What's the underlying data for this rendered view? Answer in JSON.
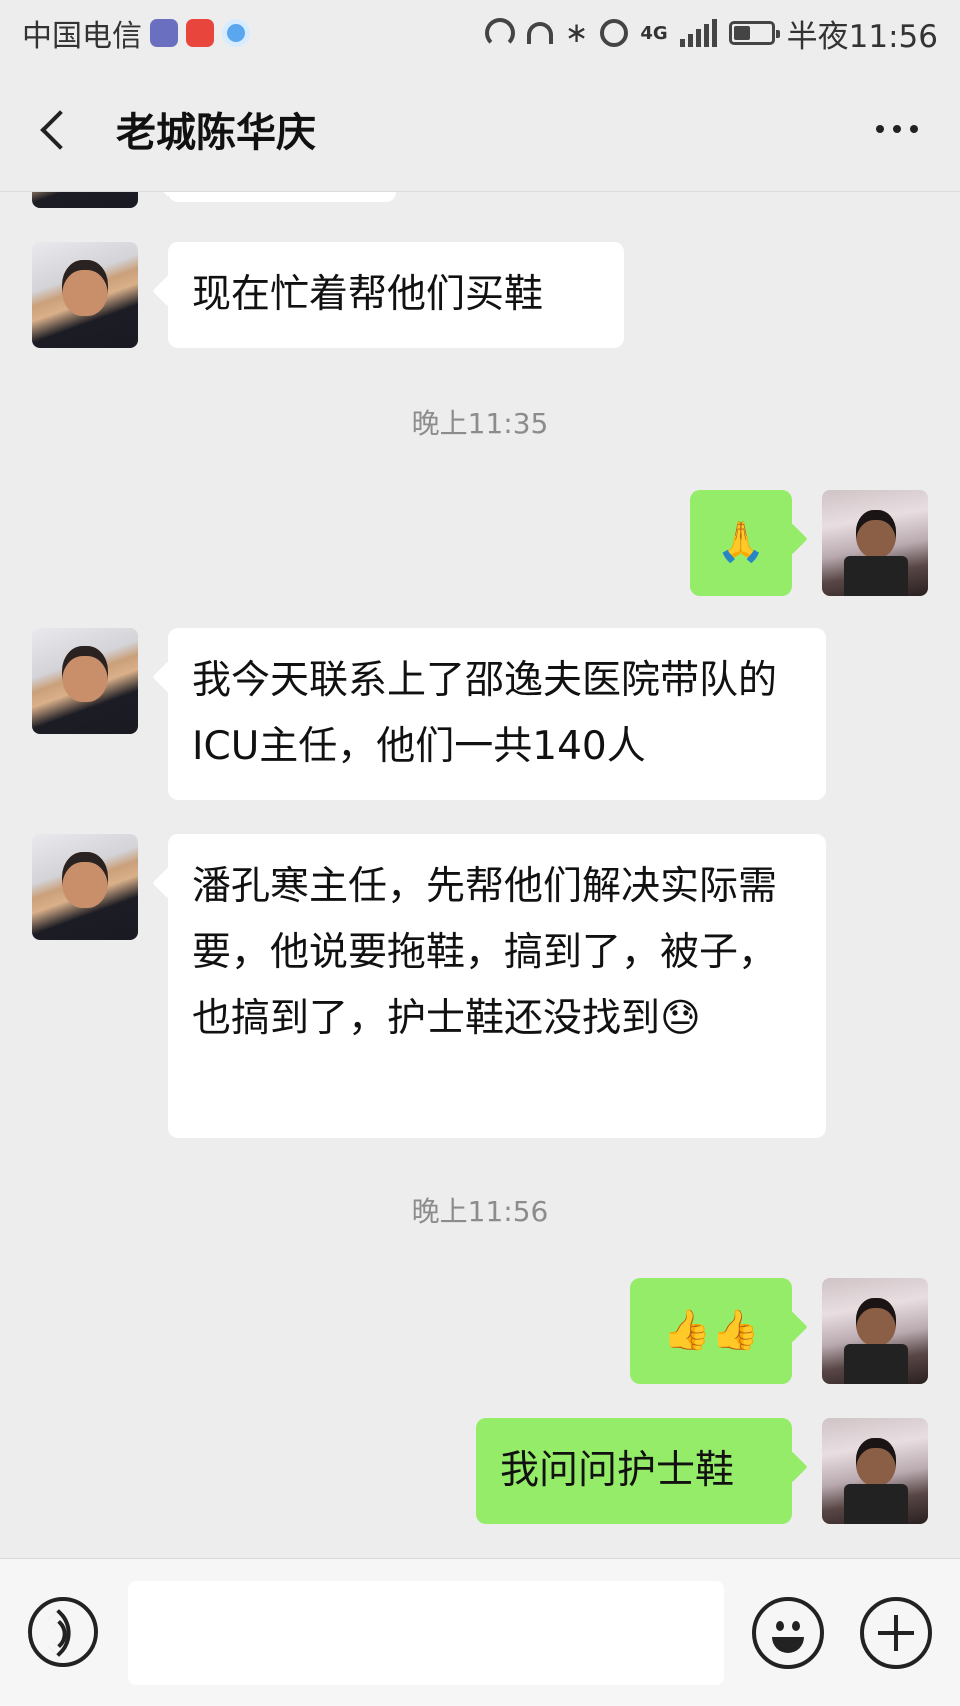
{
  "status_bar": {
    "carrier": "中国电信",
    "network_label": "4G",
    "time": "半夜11:56",
    "bluetooth_glyph": "∗",
    "icons": [
      "shield-app-icon",
      "news-app-icon",
      "browser-app-icon",
      "hotspot-icon",
      "headset-icon",
      "bluetooth-icon",
      "alarm-icon",
      "signal-icon",
      "battery-icon"
    ]
  },
  "header": {
    "title": "老城陈华庆",
    "back_icon": "chevron-left-icon",
    "more_icon": "more-dots-icon"
  },
  "messages": [
    {
      "side": "in",
      "text": "现在忙着帮他们买鞋"
    },
    {
      "type": "time",
      "text": "晚上11:35"
    },
    {
      "side": "out",
      "text": "🙏"
    },
    {
      "side": "in",
      "text": "我今天联系上了邵逸夫医院带队的ICU主任，他们一共140人"
    },
    {
      "side": "in",
      "text": "潘孔寒主任，先帮他们解决实际需要，他说要拖鞋，搞到了，被子，也搞到了，护士鞋还没找到😓"
    },
    {
      "type": "time",
      "text": "晚上11:56"
    },
    {
      "side": "out",
      "text": "👍👍"
    },
    {
      "side": "out",
      "text": "我问问护士鞋"
    }
  ],
  "input_bar": {
    "value": "",
    "icons": [
      "voice-icon",
      "emoji-icon",
      "plus-icon"
    ]
  },
  "colors": {
    "background": "#ededed",
    "outgoing_bubble": "#95ec69",
    "incoming_bubble": "#ffffff",
    "timestamp_text": "#8c8c8c"
  }
}
